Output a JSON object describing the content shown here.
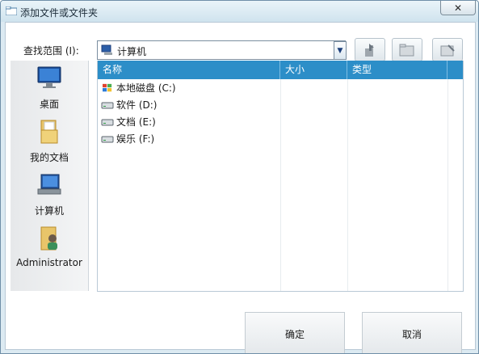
{
  "window": {
    "title": "添加文件或文件夹",
    "close_label": "✕"
  },
  "look_in": {
    "label": "查找范围 (I):",
    "value": "计算机"
  },
  "toolbar": {
    "up_icon": "up-folder-icon",
    "new_folder_icon": "new-folder-icon",
    "view_icon": "view-menu-icon"
  },
  "places": [
    {
      "label": "桌面",
      "icon": "desktop-icon"
    },
    {
      "label": "我的文档",
      "icon": "documents-folder-icon"
    },
    {
      "label": "计算机",
      "icon": "computer-icon"
    },
    {
      "label": "Administrator",
      "icon": "user-folder-icon"
    }
  ],
  "columns": [
    "名称",
    "大小",
    "类型"
  ],
  "items": [
    {
      "name": "本地磁盘 (C:)",
      "icon": "system-drive-icon"
    },
    {
      "name": "软件 (D:)",
      "icon": "drive-icon"
    },
    {
      "name": "文档 (E:)",
      "icon": "drive-icon"
    },
    {
      "name": "娱乐 (F:)",
      "icon": "drive-icon"
    }
  ],
  "buttons": {
    "ok": "确定",
    "cancel": "取消"
  },
  "colors": {
    "header": "#2c8ec8",
    "titlebar": "#d6e8f1"
  }
}
